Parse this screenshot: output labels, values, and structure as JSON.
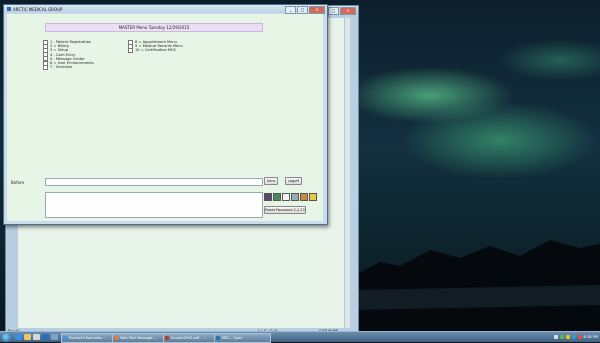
{
  "background_window": {
    "status_left": "Ready",
    "status_mid": "Lo G. Cell",
    "status_right": "CAP  NUM"
  },
  "main_window": {
    "title": "ARCTIC MEDICAL GROUP",
    "header": "MASTER Menu   Tuesday   12/29/2015",
    "menu_left": [
      "1 - Patient Registration",
      "2 = Billing",
      "3 = Setup",
      "4 - Cash Entry",
      "5 - Message Center",
      "6 = User Enhancements",
      "7 - Schedule"
    ],
    "menu_right": [
      "8 = Appointment Menu",
      "9 = Medical Records Menu",
      "10 = Certification MU2"
    ],
    "before_label": "Before",
    "btn_go": "Intro",
    "btn_logoff": "Logoff",
    "btn_password": "Reset Password 2.2.23"
  },
  "taskbar": {
    "tasks": [
      "Product Informatio...",
      "Web Mail Message:...",
      "Invoice2942.pdf - ...",
      "MSC - Open"
    ],
    "clock": "6:18 PM"
  },
  "colors": {
    "header_bg": "#ecdff5",
    "client_bg": "#e7f5e7"
  }
}
